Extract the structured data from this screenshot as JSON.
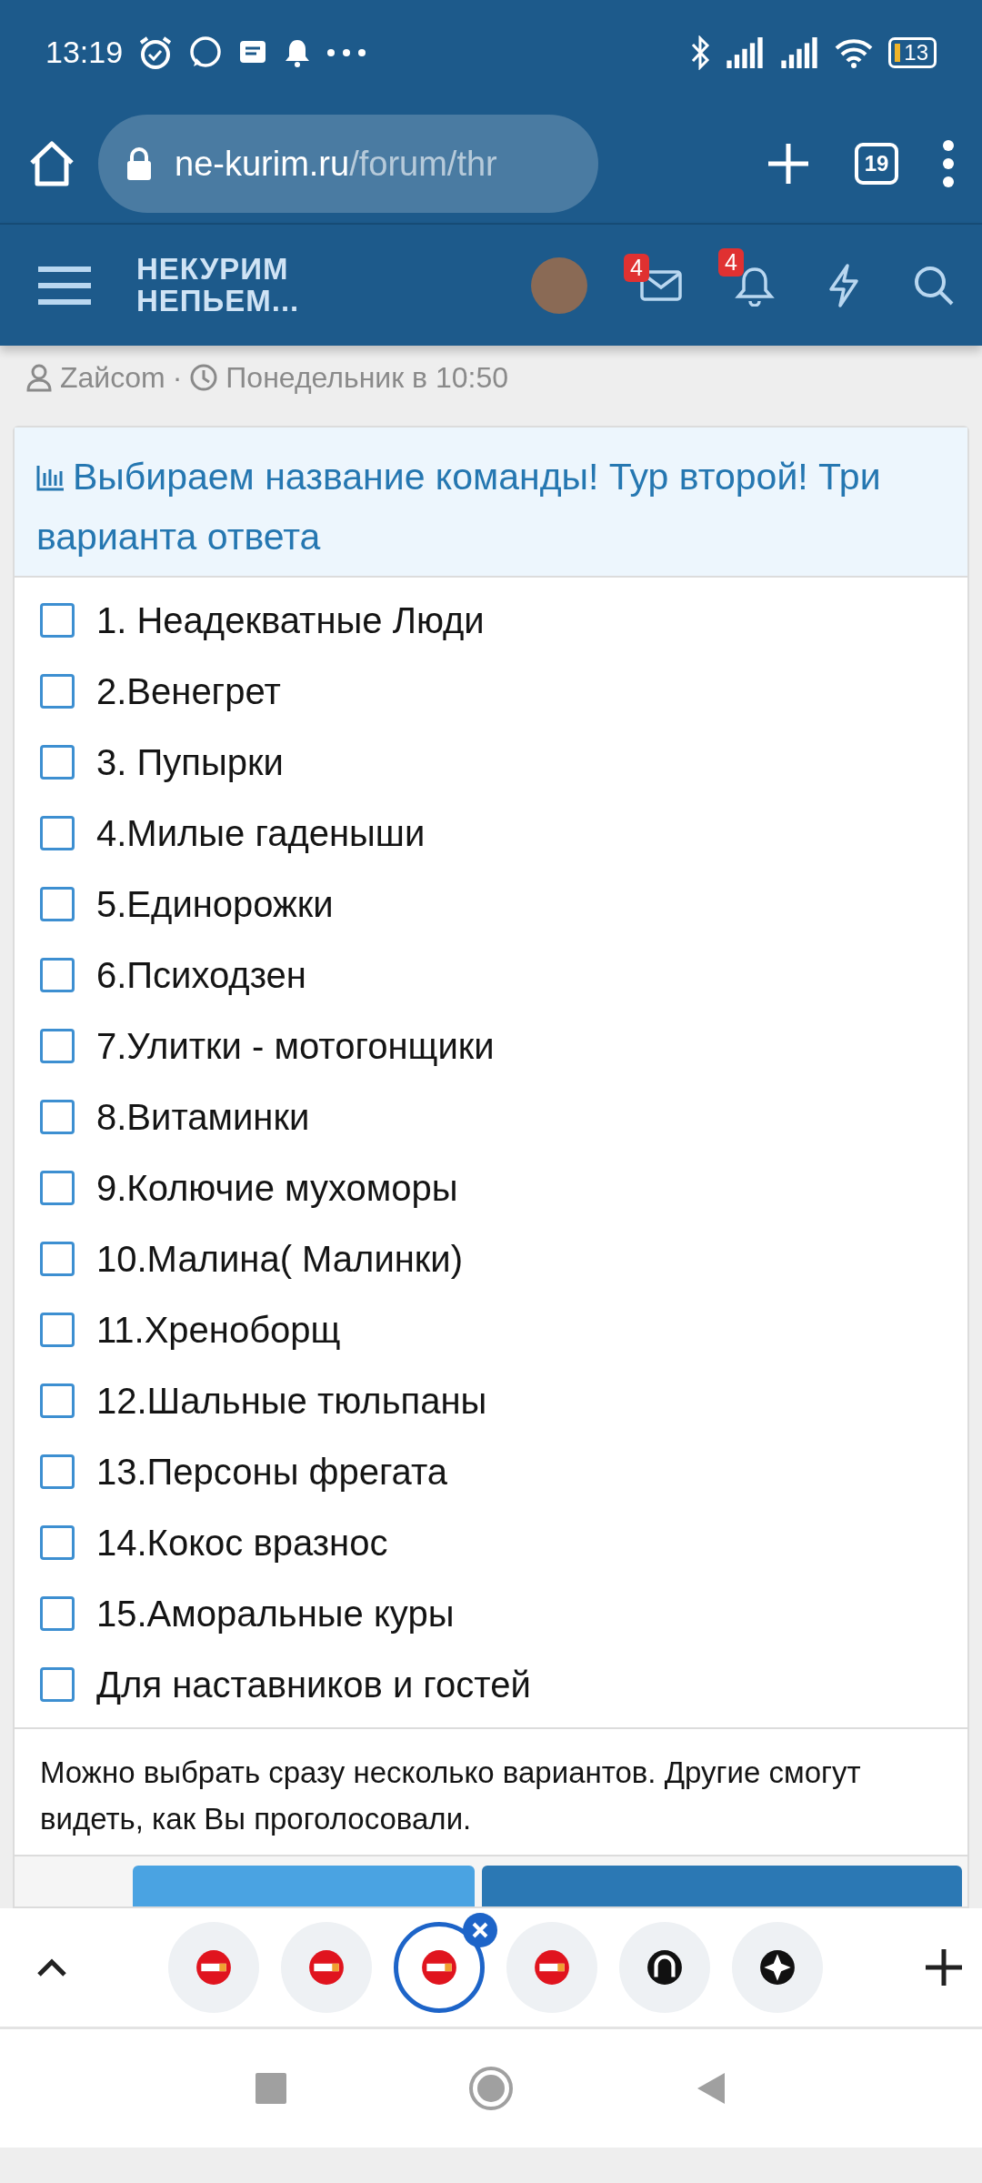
{
  "status_bar": {
    "time": "13:19",
    "battery": "13"
  },
  "browser": {
    "url_host": "ne-kurim.ru",
    "url_path": "/forum/thr",
    "tab_count": "19"
  },
  "site_header": {
    "logo_line_1": "НЕКУРИМ",
    "logo_line_2": "НЕПЬЕМ...",
    "messages_badge": "4",
    "alerts_badge": "4"
  },
  "thread": {
    "author": "Zaйcom",
    "separator": "·",
    "date": "Понедельник в 10:50"
  },
  "poll": {
    "title": "Выбираем название команды! Тур второй! Три варианта ответа",
    "options": [
      {
        "label": "1. Неадекватные Люди",
        "checked": false
      },
      {
        "label": "2.Венегрет",
        "checked": false
      },
      {
        "label": "3. Пупырки",
        "checked": false
      },
      {
        "label": "4.Милые гаденыши",
        "checked": false
      },
      {
        "label": "5.Единорожки",
        "checked": false
      },
      {
        "label": "6.Психодзен",
        "checked": false
      },
      {
        "label": "7.Улитки - мотогонщики",
        "checked": false
      },
      {
        "label": "8.Витаминки",
        "checked": false
      },
      {
        "label": "9.Колючие мухоморы",
        "checked": false
      },
      {
        "label": "10.Малина( Малинки)",
        "checked": false
      },
      {
        "label": "11.Хреноборщ",
        "checked": false
      },
      {
        "label": "12.Шальные тюльпаны",
        "checked": false
      },
      {
        "label": "13.Персоны фрегата",
        "checked": false
      },
      {
        "label": "14.Кокос вразнос",
        "checked": false
      },
      {
        "label": "15.Аморальные куры",
        "checked": false
      },
      {
        "label": "Для наставников и гостей",
        "checked": false
      }
    ],
    "note": "Можно выбрать сразу несколько вариантов. Другие смогут видеть, как Вы проголосовали."
  },
  "tab_strip": {
    "tabs": [
      {
        "kind": "no-smoking",
        "selected": false
      },
      {
        "kind": "no-smoking",
        "selected": false
      },
      {
        "kind": "no-smoking",
        "selected": true
      },
      {
        "kind": "no-smoking",
        "selected": false
      },
      {
        "kind": "horseshoe",
        "selected": false
      },
      {
        "kind": "compass",
        "selected": false
      }
    ]
  }
}
